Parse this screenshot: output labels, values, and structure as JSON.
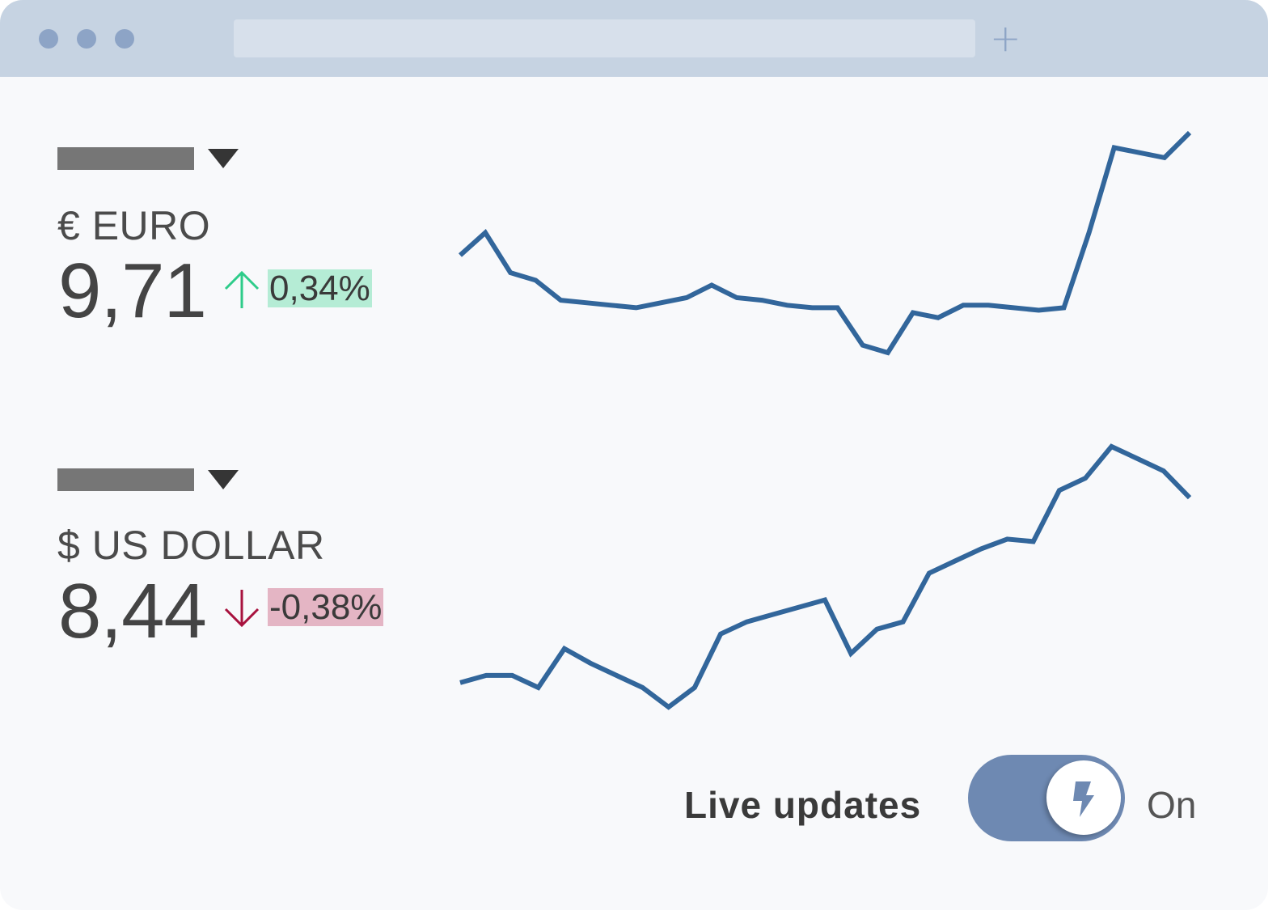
{
  "browser": {
    "new_tab_label": "+"
  },
  "currencies": [
    {
      "name": "€ EURO",
      "rate": "9,71",
      "change": "0,34%",
      "direction": "up",
      "color": "#2ecc8a",
      "sparkline": [
        57,
        66,
        50,
        47,
        39,
        38,
        37,
        36,
        38,
        40,
        45,
        40,
        39,
        37,
        36,
        36,
        21,
        18,
        34,
        32,
        37,
        37,
        36,
        35,
        36,
        66,
        100,
        98,
        96,
        106
      ]
    },
    {
      "name": "$ US DOLLAR",
      "rate": "8,44",
      "change": "-0,38%",
      "direction": "down",
      "color": "#a8123e",
      "sparkline": [
        10,
        13,
        13,
        8,
        24,
        18,
        13,
        8,
        0,
        8,
        30,
        35,
        38,
        41,
        44,
        22,
        32,
        35,
        55,
        60,
        65,
        69,
        68,
        89,
        94,
        107,
        102,
        97,
        86
      ]
    }
  ],
  "live_updates": {
    "label": "Live updates",
    "state": "On",
    "enabled": true
  },
  "colors": {
    "line": "#32669b",
    "toggle_track": "#6e89b2",
    "titlebar": "#c6d3e2"
  }
}
